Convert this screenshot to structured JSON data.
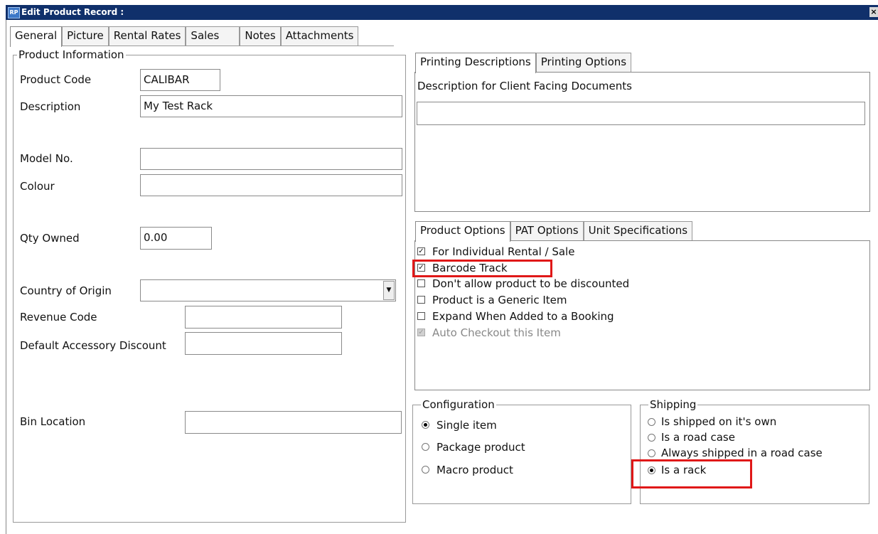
{
  "window": {
    "app_icon": "RP",
    "title": "Edit Product Record :",
    "close_glyph": "×"
  },
  "tabs": [
    "General",
    "Picture",
    "Rental Rates",
    "Sales",
    "Notes",
    "Attachments"
  ],
  "product_info": {
    "legend": "Product Information",
    "product_code_label": "Product Code",
    "product_code": "CALIBAR",
    "description_label": "Description",
    "description": "My Test Rack",
    "model_no_label": "Model No.",
    "model_no": "",
    "colour_label": "Colour",
    "colour": "",
    "qty_owned_label": "Qty Owned",
    "qty_owned": "0.00",
    "country_label": "Country of Origin",
    "country": "",
    "revenue_code_label": "Revenue Code",
    "revenue_code": "",
    "default_discount_label": "Default Accessory Discount",
    "default_discount": "",
    "bin_location_label": "Bin Location",
    "bin_location": ""
  },
  "printing": {
    "tabs": [
      "Printing Descriptions",
      "Printing Options"
    ],
    "desc_label": "Description for Client Facing Documents",
    "desc_value": ""
  },
  "product_options": {
    "tabs": [
      "Product Options",
      "PAT Options",
      "Unit Specifications"
    ],
    "items": [
      {
        "label": "For Individual Rental / Sale",
        "checked": true,
        "disabled": false
      },
      {
        "label": "Barcode Track",
        "checked": true,
        "disabled": false
      },
      {
        "label": "Don't allow product to be discounted",
        "checked": false,
        "disabled": false
      },
      {
        "label": "Product is a Generic Item",
        "checked": false,
        "disabled": false
      },
      {
        "label": "Expand When Added to a Booking",
        "checked": false,
        "disabled": false
      },
      {
        "label": "Auto Checkout this Item",
        "checked": true,
        "disabled": true
      }
    ]
  },
  "configuration": {
    "legend": "Configuration",
    "options": [
      "Single item",
      "Package product",
      "Macro product"
    ],
    "selected": "Single item"
  },
  "shipping": {
    "legend": "Shipping",
    "options": [
      "Is shipped on it's own",
      "Is a road case",
      "Always shipped in a road case",
      "Is a rack"
    ],
    "selected": "Is a rack"
  },
  "colors": {
    "title_bar": "#10306b",
    "highlight": "#e01818"
  }
}
